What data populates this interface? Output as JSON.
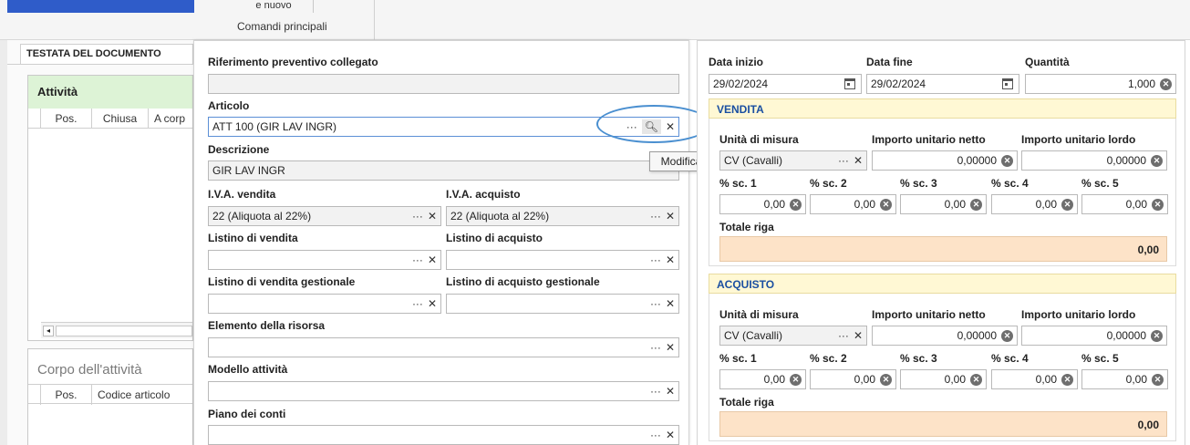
{
  "ribbon": {
    "new_label": "e nuovo",
    "group_label": "Comandi principali"
  },
  "left": {
    "tab_label": "TESTATA DEL DOCUMENTO",
    "activities_title": "Attività",
    "activities_columns": [
      "Pos.",
      "Chiusa",
      "A corp"
    ],
    "body_title": "Corpo dell'attività",
    "body_columns": [
      "Pos.",
      "Codice articolo"
    ]
  },
  "form": {
    "rif_label": "Riferimento preventivo collegato",
    "rif_value": "",
    "articolo_label": "Articolo",
    "articolo_value": "ATT 100 (GIR LAV INGR)",
    "tooltip": "Modifica",
    "descrizione_label": "Descrizione",
    "descrizione_value": "GIR LAV INGR",
    "iva_vendita_label": "I.V.A. vendita",
    "iva_vendita_value": "22 (Aliquota al 22%)",
    "iva_acquisto_label": "I.V.A. acquisto",
    "iva_acquisto_value": "22 (Aliquota al 22%)",
    "listino_vendita_label": "Listino di vendita",
    "listino_acquisto_label": "Listino di acquisto",
    "listino_vendita_gest_label": "Listino di vendita gestionale",
    "listino_acquisto_gest_label": "Listino di acquisto gestionale",
    "elemento_label": "Elemento della risorsa",
    "modello_label": "Modello attività",
    "piano_label": "Piano dei conti"
  },
  "right": {
    "data_inizio_label": "Data inizio",
    "data_inizio_value": "29/02/2024",
    "data_fine_label": "Data fine",
    "data_fine_value": "29/02/2024",
    "quantita_label": "Quantità",
    "quantita_value": "1,000",
    "vendita": {
      "title": "VENDITA",
      "um_label": "Unità di misura",
      "um_value": "CV (Cavalli)",
      "netto_label": "Importo unitario netto",
      "netto_value": "0,00000",
      "lordo_label": "Importo unitario lordo",
      "lordo_value": "0,00000",
      "sc_labels": [
        "% sc. 1",
        "% sc. 2",
        "% sc. 3",
        "% sc. 4",
        "% sc. 5"
      ],
      "sc_values": [
        "0,00",
        "0,00",
        "0,00",
        "0,00",
        "0,00"
      ],
      "totale_label": "Totale riga",
      "totale_value": "0,00"
    },
    "acquisto": {
      "title": "ACQUISTO",
      "um_label": "Unità di misura",
      "um_value": "CV (Cavalli)",
      "netto_label": "Importo unitario netto",
      "netto_value": "0,00000",
      "lordo_label": "Importo unitario lordo",
      "lordo_value": "0,00000",
      "sc_labels": [
        "% sc. 1",
        "% sc. 2",
        "% sc. 3",
        "% sc. 4",
        "% sc. 5"
      ],
      "sc_values": [
        "0,00",
        "0,00",
        "0,00",
        "0,00",
        "0,00"
      ],
      "totale_label": "Totale riga",
      "totale_value": "0,00"
    }
  },
  "colors": {
    "accent": "#1a4fa1",
    "section_bg": "#fff8d4",
    "total_bg": "#fde3c8",
    "activities_bg": "#ddf3d6",
    "highlight_circle": "#4a8fd0"
  }
}
